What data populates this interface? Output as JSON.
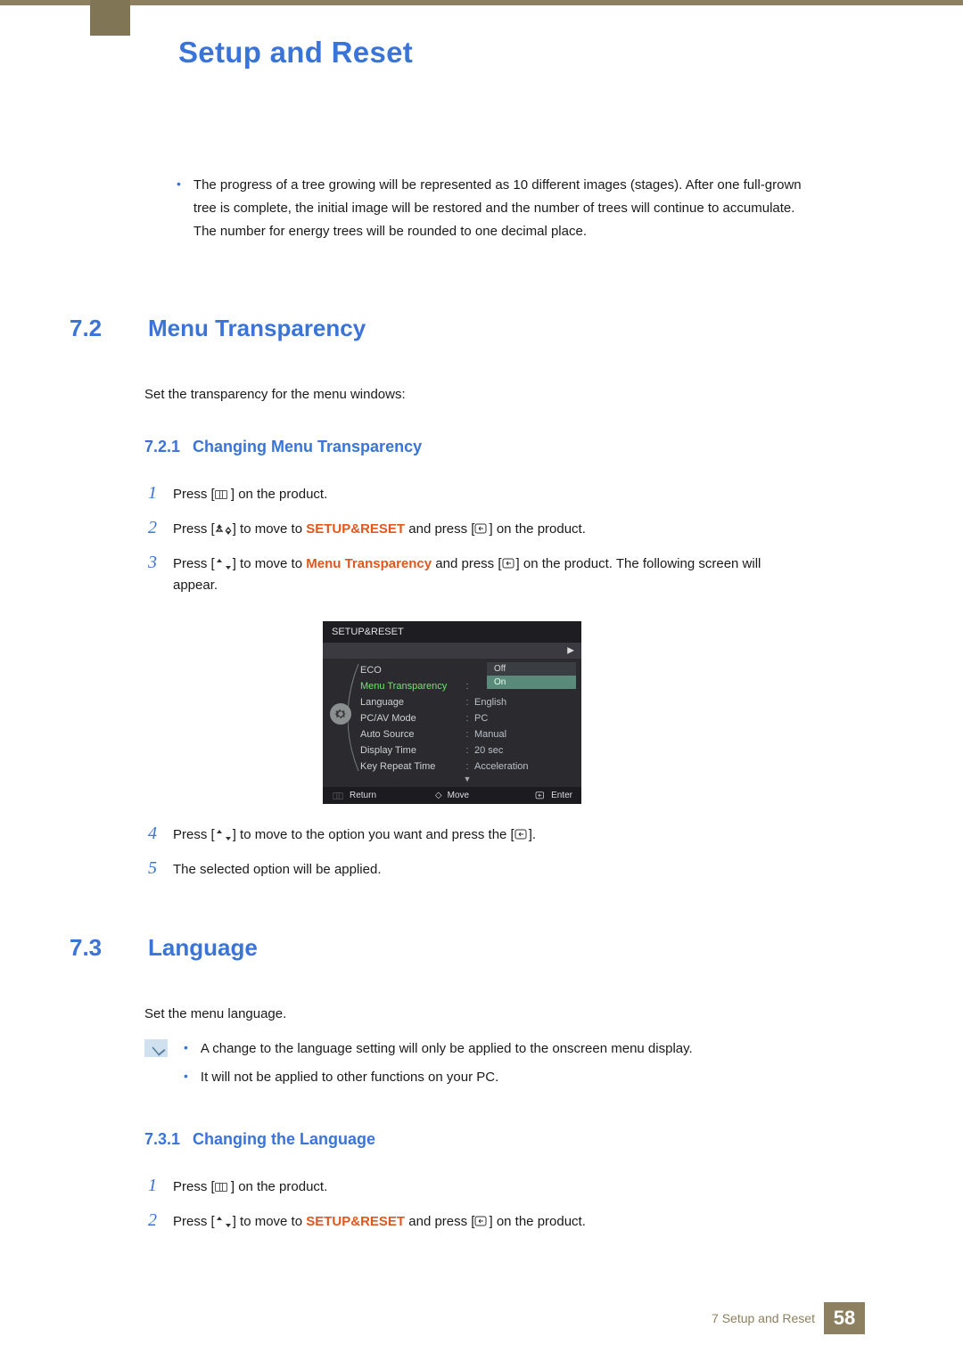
{
  "chapter": {
    "title": "Setup and Reset"
  },
  "intro_bullet": "The progress of a tree growing will be represented as 10 different images (stages). After one full-grown tree is complete, the initial image will be restored and the number of trees will continue to accumulate. The number for energy trees will be rounded to one decimal place.",
  "section72": {
    "num": "7.2",
    "title": "Menu Transparency",
    "desc": "Set the transparency for the menu windows:",
    "sub": {
      "num": "7.2.1",
      "title": "Changing Menu Transparency"
    },
    "steps": {
      "s1": "Press [",
      "s1b": " ] on the product.",
      "s2a": "Press [",
      "s2b": "] to move to ",
      "s2c": "SETUP&RESET",
      "s2d": " and press [",
      "s2e": "] on the product.",
      "s3a": "Press [",
      "s3b": "] to move to ",
      "s3c": "Menu Transparency",
      "s3d": " and press [",
      "s3e": "] on the product. The following screen will appear.",
      "s4a": "Press [",
      "s4b": "] to move to the option you want and press the [",
      "s4c": "].",
      "s5": "The selected option will be applied."
    }
  },
  "osd": {
    "title": "SETUP&RESET",
    "rows": [
      {
        "label": "ECO",
        "value": ""
      },
      {
        "label": "Menu Transparency",
        "value": "On",
        "selected": true
      },
      {
        "label": "Language",
        "value": "English"
      },
      {
        "label": "PC/AV Mode",
        "value": "PC"
      },
      {
        "label": "Auto Source",
        "value": "Manual"
      },
      {
        "label": "Display Time",
        "value": "20 sec"
      },
      {
        "label": "Key Repeat Time",
        "value": "Acceleration"
      }
    ],
    "popup": {
      "opt_off": "Off",
      "opt_on": "On"
    },
    "footer": {
      "return": "Return",
      "move": "Move",
      "enter": "Enter"
    }
  },
  "section73": {
    "num": "7.3",
    "title": "Language",
    "desc": "Set the menu language.",
    "notes": {
      "n1": "A change to the language setting will only be applied to the onscreen menu display.",
      "n2": "It will not be applied to other functions on your PC."
    },
    "sub": {
      "num": "7.3.1",
      "title": "Changing the Language"
    },
    "steps": {
      "s1": "Press [",
      "s1b": " ] on the product.",
      "s2a": "Press [",
      "s2b": "] to move to ",
      "s2c": "SETUP&RESET",
      "s2d": " and press [",
      "s2e": "] on the product."
    }
  },
  "footer": {
    "crumb": "7 Setup and Reset",
    "page": "58"
  },
  "step_numbers": {
    "n1": "1",
    "n2": "2",
    "n3": "3",
    "n4": "4",
    "n5": "5"
  }
}
